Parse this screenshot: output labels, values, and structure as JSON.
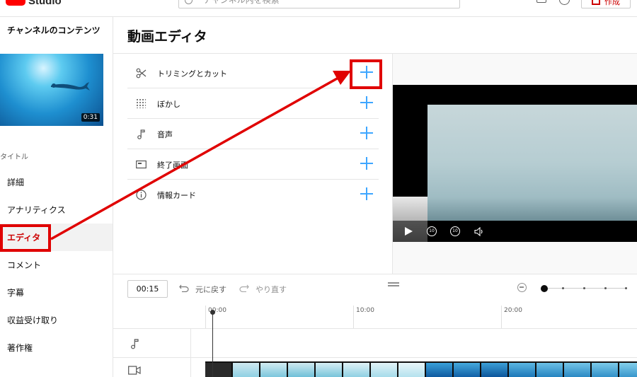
{
  "header": {
    "logo_text": "Studio",
    "search_placeholder": "チャンネル内を検索",
    "create_label": "作成"
  },
  "sidebar": {
    "channel_title": "チャンネルのコンテンツ",
    "thumb_duration": "0:31",
    "section_label": "タイトル",
    "items": [
      {
        "label": "詳細",
        "active": false
      },
      {
        "label": "アナリティクス",
        "active": false
      },
      {
        "label": "エディタ",
        "active": true
      },
      {
        "label": "コメント",
        "active": false
      },
      {
        "label": "字幕",
        "active": false
      },
      {
        "label": "収益受け取り",
        "active": false
      },
      {
        "label": "著作権",
        "active": false
      }
    ]
  },
  "main": {
    "page_title": "動画エディタ",
    "tools": [
      {
        "label": "トリミングとカット",
        "icon": "scissors-icon"
      },
      {
        "label": "ぼかし",
        "icon": "blur-icon"
      },
      {
        "label": "音声",
        "icon": "music-note-icon"
      },
      {
        "label": "終了画面",
        "icon": "end-screen-icon"
      },
      {
        "label": "情報カード",
        "icon": "info-icon"
      }
    ],
    "player": {
      "skip_back_label": "10",
      "skip_forward_label": "10"
    }
  },
  "timeline": {
    "timecode": "00:15",
    "undo_label": "元に戻す",
    "redo_label": "やり直す",
    "ruler_labels": [
      "00:00",
      "10:00",
      "20:00"
    ],
    "zoom_level": 0
  },
  "annotation": {
    "color": "#e00000"
  },
  "colors": {
    "accent_red": "#cc0000",
    "add_blue": "#3ea6ff"
  }
}
